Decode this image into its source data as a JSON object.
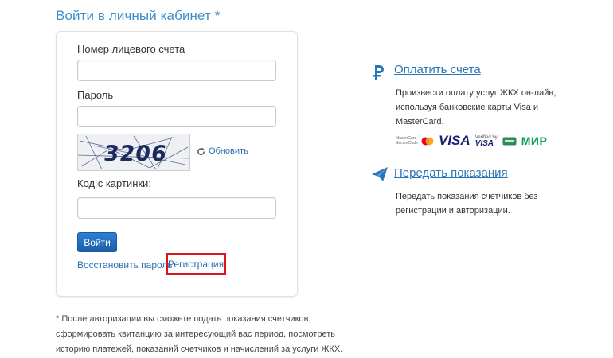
{
  "login": {
    "title": "Войти в личный кабинет *",
    "account_label": "Номер лицевого счета",
    "password_label": "Пароль",
    "captcha_code": "3206",
    "refresh_label": "Обновить",
    "captcha_label": "Код с картинки:",
    "submit_label": "Войти",
    "restore_link": "Восстановить пароль",
    "register_link": "Регистрация"
  },
  "footnote": "* После авторизации вы сможете подать показания счетчиков, сформировать квитанцию за интересующий вас период, посмотреть историю платежей, показаний счетчиков и начислений за услуги ЖКХ.",
  "services": [
    {
      "icon": "ruble-icon",
      "title": "Оплатить счета",
      "description": "Произвести оплату услуг ЖКХ он-лайн, используя банковские карты Visa и MasterCard."
    },
    {
      "icon": "paper-plane-icon",
      "title": "Передать показания",
      "description": "Передать показания счетчиков без регистрации и авторизации."
    }
  ],
  "payment_logos": {
    "mastercard": "MasterCard SecureCode",
    "visa": "VISA",
    "verified_by_visa": [
      "Verified by",
      "VISA"
    ],
    "mir": "МИР"
  },
  "colors": {
    "accent": "#3d8ec9",
    "link": "#2a6fb0",
    "button": "#1b5fab",
    "highlight": "#d9141c"
  }
}
